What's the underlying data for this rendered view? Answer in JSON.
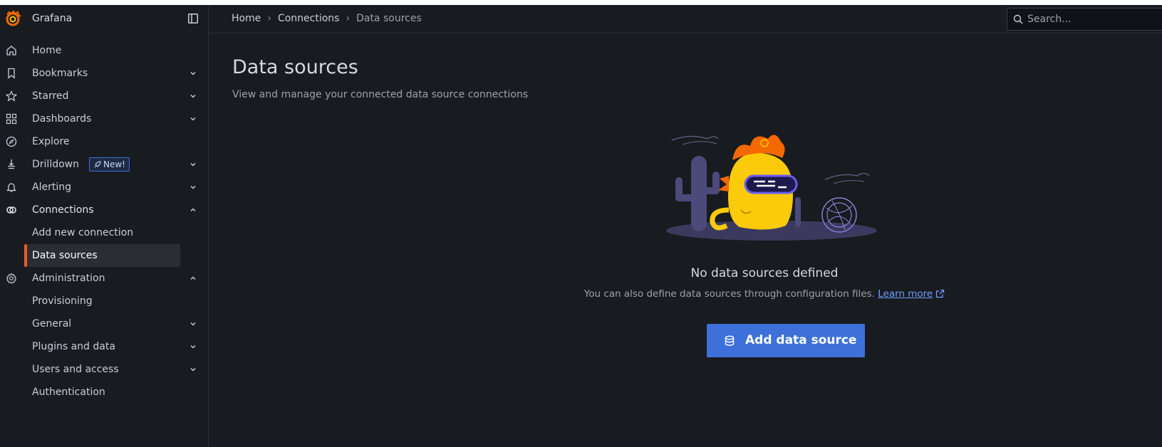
{
  "app": {
    "name": "Grafana"
  },
  "sidebar": {
    "items": [
      {
        "label": "Home",
        "icon": "home-icon",
        "chevron": ""
      },
      {
        "label": "Bookmarks",
        "icon": "bookmark-icon",
        "chevron": "down"
      },
      {
        "label": "Starred",
        "icon": "star-icon",
        "chevron": "down"
      },
      {
        "label": "Dashboards",
        "icon": "apps-icon",
        "chevron": "down"
      },
      {
        "label": "Explore",
        "icon": "compass-icon",
        "chevron": ""
      },
      {
        "label": "Drilldown",
        "icon": "drilldown-icon",
        "chevron": "down",
        "badge": "New!"
      },
      {
        "label": "Alerting",
        "icon": "bell-icon",
        "chevron": "down"
      },
      {
        "label": "Connections",
        "icon": "link-icon",
        "chevron": "up"
      },
      {
        "label": "Add new connection",
        "icon": "",
        "chevron": ""
      },
      {
        "label": "Data sources",
        "icon": "",
        "chevron": "",
        "active": true
      },
      {
        "label": "Administration",
        "icon": "cog-icon",
        "chevron": "up"
      },
      {
        "label": "Provisioning",
        "icon": "",
        "chevron": ""
      },
      {
        "label": "General",
        "icon": "",
        "chevron": "down"
      },
      {
        "label": "Plugins and data",
        "icon": "",
        "chevron": "down"
      },
      {
        "label": "Users and access",
        "icon": "",
        "chevron": "down"
      },
      {
        "label": "Authentication",
        "icon": "",
        "chevron": ""
      }
    ]
  },
  "breadcrumb": [
    "Home",
    "Connections",
    "Data sources"
  ],
  "search": {
    "placeholder": "Search..."
  },
  "page": {
    "title": "Data sources",
    "subtitle": "View and manage your connected data source connections"
  },
  "empty_state": {
    "title": "No data sources defined",
    "text": "You can also define data sources through configuration files.",
    "link": "Learn more",
    "button": "Add data source"
  },
  "colors": {
    "accent": "#3d71d9",
    "active_bar": "#f05a28",
    "background": "#181b1f",
    "link": "#6e9fff"
  }
}
